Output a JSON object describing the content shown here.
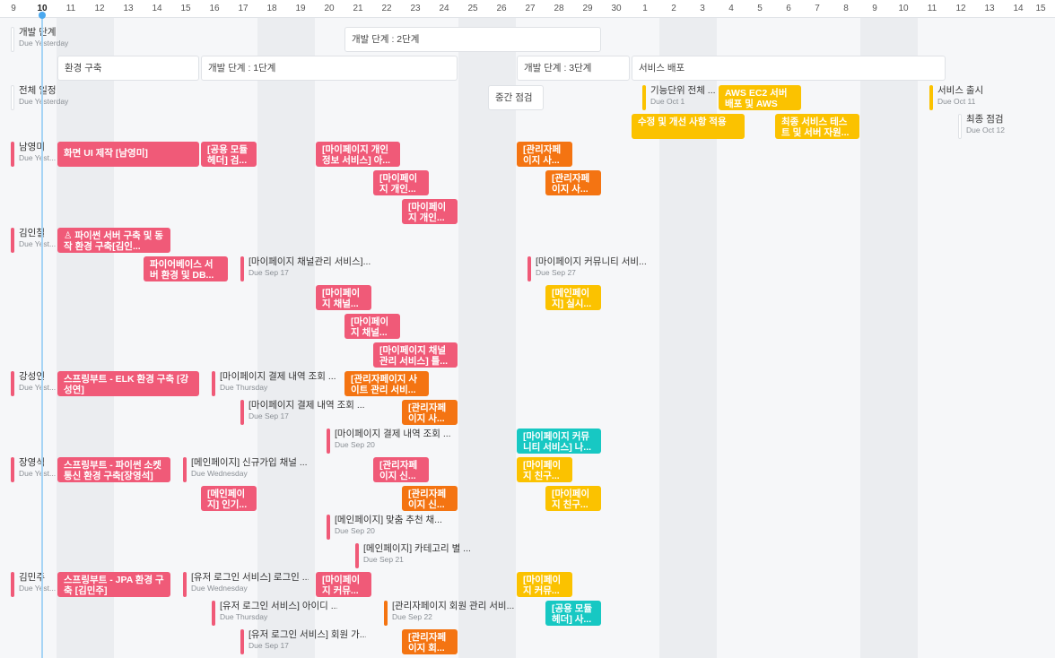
{
  "header": {
    "dates": [
      "9",
      "10",
      "11",
      "12",
      "13",
      "14",
      "15",
      "16",
      "17",
      "18",
      "19",
      "20",
      "21",
      "22",
      "23",
      "24",
      "25",
      "26",
      "27",
      "28",
      "29",
      "30",
      "1",
      "2",
      "3",
      "4",
      "5",
      "6",
      "7",
      "8",
      "9",
      "10",
      "11",
      "12",
      "13",
      "14",
      "15"
    ],
    "today": "10"
  },
  "colors": {
    "pink": "#f05a78",
    "orange": "#f47412",
    "yellow": "#fbc200",
    "teal": "#17c8c3",
    "today_line": "#4aa8ef"
  },
  "bars": [
    {
      "id": "phase2",
      "text": "개발 단계 : 2단계",
      "color": "white"
    },
    {
      "id": "env-setup",
      "text": "환경 구축",
      "color": "white"
    },
    {
      "id": "phase1",
      "text": "개발 단계 : 1단계",
      "color": "white"
    },
    {
      "id": "phase3",
      "text": "개발 단계 : 3단계",
      "color": "white"
    },
    {
      "id": "service-deploy",
      "text": "서비스 배포",
      "color": "white"
    },
    {
      "id": "midpoint",
      "text": "중간 점검",
      "color": "white"
    },
    {
      "id": "aws-ec2",
      "text": "AWS EC2 서버 배포 및 AWS RDS...",
      "color": "yellow"
    },
    {
      "id": "fixes",
      "text": "수정 및 개선 사항 적용",
      "color": "yellow"
    },
    {
      "id": "final-test",
      "text": "최종 서비스 테스트 및 서버 자원...",
      "color": "yellow"
    },
    {
      "id": "ui-design",
      "text": "화면 UI 제작 [남영미]",
      "color": "pink"
    },
    {
      "id": "common-header",
      "text": "[공용 모듈 헤더] 검...",
      "color": "pink"
    },
    {
      "id": "mypage-privacy",
      "text": "[마이페이지 개인정보 서비스] 아...",
      "color": "pink"
    },
    {
      "id": "mypage-personal-1",
      "text": "[마이페이지 개인...",
      "color": "pink"
    },
    {
      "id": "mypage-personal-2",
      "text": "[마이페이지 개인...",
      "color": "pink"
    },
    {
      "id": "admin-1",
      "text": "[관리자페이지 사...",
      "color": "orange"
    },
    {
      "id": "admin-2",
      "text": "[관리자페이지 사...",
      "color": "orange"
    },
    {
      "id": "python-server",
      "text": "파이썬 서버 구축 및 동작 환경 구축[김인...",
      "color": "pink",
      "icon": "user-icon"
    },
    {
      "id": "firebase",
      "text": "파이어베이스 서버 환경 및 DB...",
      "color": "pink"
    },
    {
      "id": "channel-1",
      "text": "[마이페이지 채널...",
      "color": "pink"
    },
    {
      "id": "channel-2",
      "text": "[마이페이지 채널...",
      "color": "pink"
    },
    {
      "id": "channel-3",
      "text": "[마이페이지 채널 관리 서비스] 틀...",
      "color": "pink"
    },
    {
      "id": "realtime",
      "text": "[메인페이지] 실시...",
      "color": "yellow"
    },
    {
      "id": "spring-elk",
      "text": "스프링부트 - ELK 환경 구축 [강성연]",
      "color": "pink"
    },
    {
      "id": "admin-site",
      "text": "[관리자페이지 사이트 관리 서비...",
      "color": "orange"
    },
    {
      "id": "admin-3",
      "text": "[관리자페이지 사...",
      "color": "orange"
    },
    {
      "id": "community-teal",
      "text": "[마이페이지 커뮤니티 서비스] 나...",
      "color": "teal"
    },
    {
      "id": "spring-socket",
      "text": "스프링부트 - 파이썬 소켓 통신 환경 구축[장영석]",
      "color": "pink"
    },
    {
      "id": "main-popular",
      "text": "[메인페이지] 인기...",
      "color": "pink"
    },
    {
      "id": "admin-4",
      "text": "[관리자페이지 신...",
      "color": "pink"
    },
    {
      "id": "admin-5",
      "text": "[관리자페이지 신...",
      "color": "orange"
    },
    {
      "id": "friends-1",
      "text": "[마이페이지 친구...",
      "color": "yellow"
    },
    {
      "id": "friends-2",
      "text": "[마이페이지 친구...",
      "color": "yellow"
    },
    {
      "id": "spring-jpa",
      "text": "스프링부트 - JPA 환경 구축 [김민주]",
      "color": "pink"
    },
    {
      "id": "community-1",
      "text": "[마이페이지 커뮤...",
      "color": "pink"
    },
    {
      "id": "community-2",
      "text": "[마이페이지 커뮤...",
      "color": "yellow"
    },
    {
      "id": "common-header-2",
      "text": "[공용 모듈 헤더] 사...",
      "color": "teal"
    },
    {
      "id": "admin-6",
      "text": "[관리자페이지 회...",
      "color": "orange"
    }
  ],
  "milestones": [
    {
      "id": "dev-stage",
      "title": "개발 단계",
      "due": "Due Yesterday",
      "color": "white"
    },
    {
      "id": "full-schedule",
      "title": "전체 일정",
      "due": "Due Yesterday",
      "color": "white"
    },
    {
      "id": "feature-all",
      "title": "기능단위 전체 ...",
      "due": "Due Oct 1",
      "color": "yellow"
    },
    {
      "id": "service-launch",
      "title": "서비스 출시",
      "due": "Due Oct 11",
      "color": "yellow"
    },
    {
      "id": "final-check",
      "title": "최종 점검",
      "due": "Due Oct 12",
      "color": "white"
    },
    {
      "id": "nam",
      "title": "남영미",
      "due": "Due Yest...",
      "color": "pink"
    },
    {
      "id": "kiminchul",
      "title": "김인철",
      "due": "Due Yest...",
      "color": "pink"
    },
    {
      "id": "channel-ms",
      "title": "[마이페이지 채널관리 서비스]...",
      "due": "Due Sep 17",
      "color": "pink"
    },
    {
      "id": "community-ms",
      "title": "[마이페이지 커뮤니티 서비...",
      "due": "Due Sep 27",
      "color": "pink"
    },
    {
      "id": "kang",
      "title": "강성연",
      "due": "Due Yest...",
      "color": "pink"
    },
    {
      "id": "payment-1",
      "title": "[마이페이지 결제 내역 조회 ...",
      "due": "Due Thursday",
      "color": "pink"
    },
    {
      "id": "payment-2",
      "title": "[마이페이지 결제 내역 조회 ...",
      "due": "Due Sep 17",
      "color": "pink"
    },
    {
      "id": "payment-3",
      "title": "[마이페이지 결제 내역 조회 ...",
      "due": "Due Sep 20",
      "color": "pink"
    },
    {
      "id": "jang",
      "title": "장영석",
      "due": "Due Yest...",
      "color": "pink"
    },
    {
      "id": "signup-channel",
      "title": "[메인페이지] 신규가입 채널 ...",
      "due": "Due Wednesday",
      "color": "pink"
    },
    {
      "id": "recommend",
      "title": "[메인페이지] 맞춤 추천 채...",
      "due": "Due Sep 20",
      "color": "pink"
    },
    {
      "id": "category",
      "title": "[메인페이지] 카테고리 별 ...",
      "due": "Due Sep 21",
      "color": "pink"
    },
    {
      "id": "kimminju",
      "title": "김민주",
      "due": "Due Yest...",
      "color": "pink"
    },
    {
      "id": "user-login",
      "title": "[유저 로그인 서비스] 로그인 ...",
      "due": "Due Wednesday",
      "color": "pink"
    },
    {
      "id": "user-id",
      "title": "[유저 로그인 서비스] 아이디 ...",
      "due": "Due Thursday",
      "color": "pink"
    },
    {
      "id": "admin-member",
      "title": "[관리자페이지 회원 관리 서비...",
      "due": "Due Sep 22",
      "color": "orange"
    },
    {
      "id": "user-member",
      "title": "[유저 로그인 서비스] 회원 가...",
      "due": "Due Sep 17",
      "color": "pink"
    }
  ]
}
